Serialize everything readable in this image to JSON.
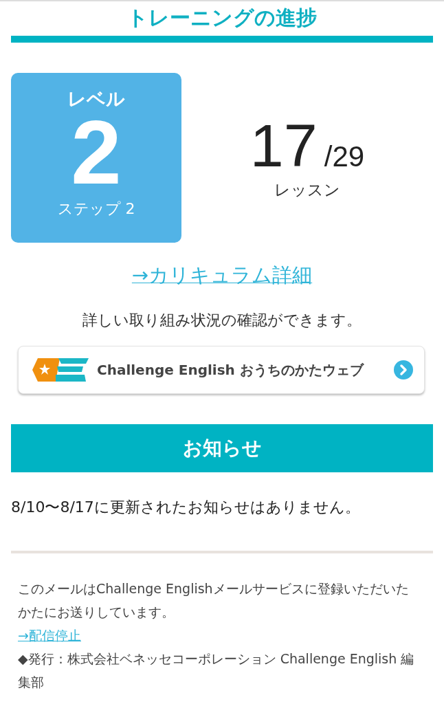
{
  "header": {
    "title": "トレーニングの進捗"
  },
  "level_card": {
    "label": "レベル",
    "level": "2",
    "step": "ステップ 2"
  },
  "progress": {
    "done": "17",
    "total": "/29",
    "unit": "レッスン"
  },
  "curriculum_link": "→カリキュラム詳細",
  "detail_text": "詳しい取り組み状況の確認ができます。",
  "banner": {
    "text": "Challenge English おうちのかたウェブ"
  },
  "notice": {
    "title": "お知らせ",
    "message": "8/10〜8/17に更新されたお知らせはありません。"
  },
  "footer": {
    "note": "このメールはChallenge Englishメールサービスに登録いただいたかたにお送りしています。",
    "unsubscribe_link": "→配信停止",
    "publisher": "◆発行：株式会社ベネッセコーポレーション Challenge English 編集部"
  }
}
